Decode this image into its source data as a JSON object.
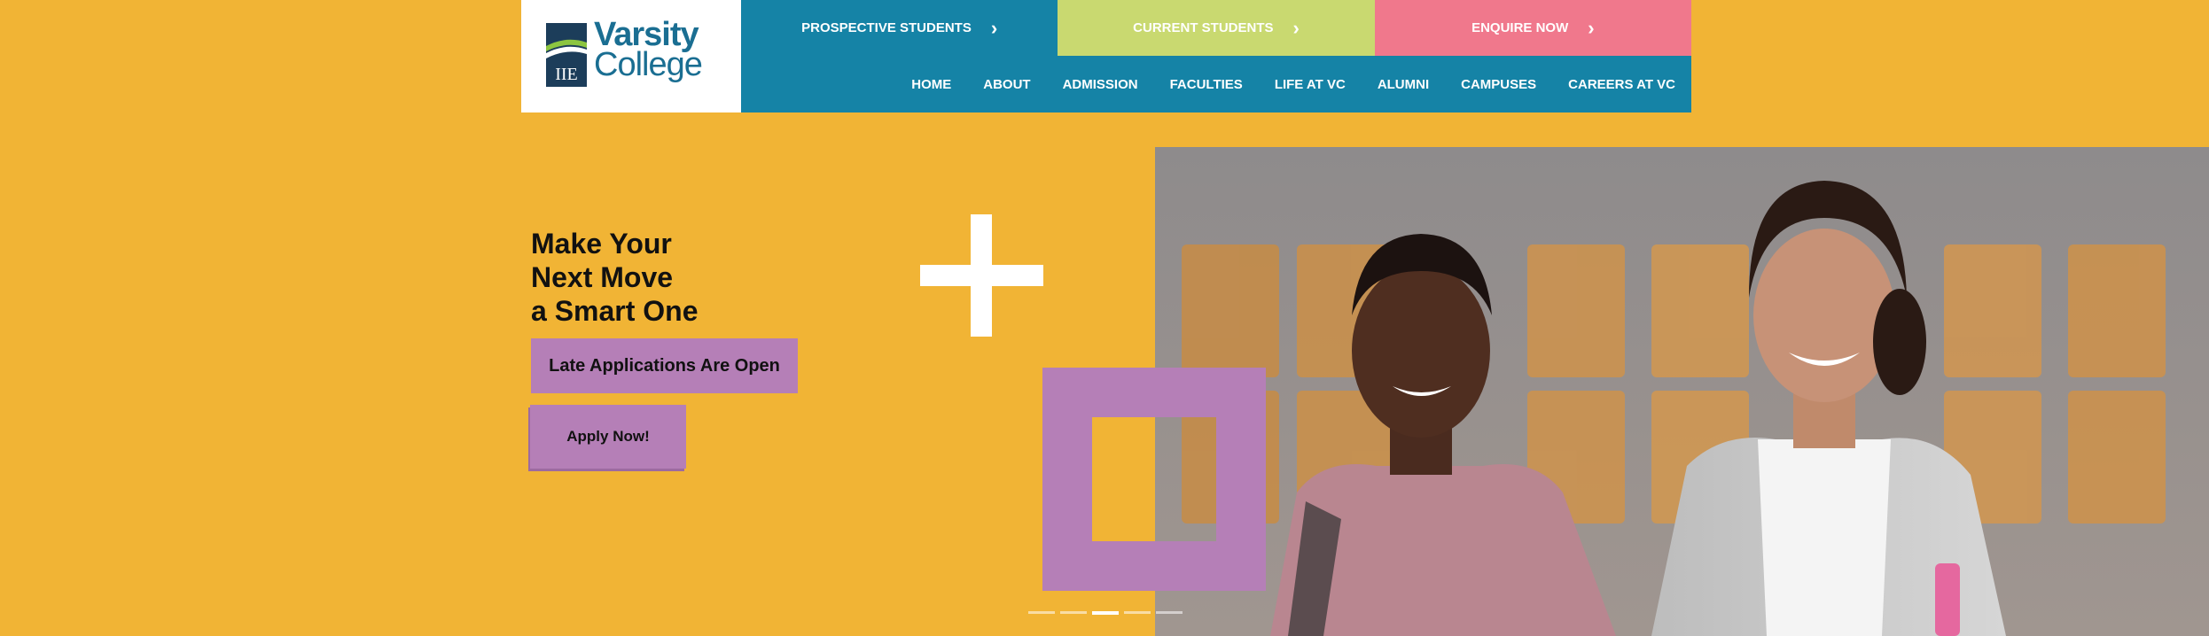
{
  "logo": {
    "line1": "Varsity",
    "line2": "College",
    "badge": "IIE"
  },
  "topbar": {
    "prospective": "PROSPECTIVE STUDENTS",
    "current": "CURRENT STUDENTS",
    "enquire": "ENQUIRE NOW",
    "chevron": "›"
  },
  "nav": {
    "items": [
      {
        "label": "HOME"
      },
      {
        "label": "ABOUT"
      },
      {
        "label": "ADMISSION"
      },
      {
        "label": "FACULTIES"
      },
      {
        "label": "LIFE AT VC"
      },
      {
        "label": "ALUMNI"
      },
      {
        "label": "CAMPUSES"
      },
      {
        "label": "CAREERS AT VC"
      }
    ]
  },
  "hero": {
    "title_lines": [
      "Make Your",
      "Next Move",
      "a Smart One"
    ],
    "badge": "Late Applications Are Open",
    "cta": "Apply Now!"
  },
  "carousel": {
    "slides": 5,
    "active_index": 2
  },
  "colors": {
    "background": "#f1b435",
    "brand_blue": "#1583a6",
    "lime": "#c9d970",
    "pink": "#f0788c",
    "purple": "#b57fb7"
  }
}
